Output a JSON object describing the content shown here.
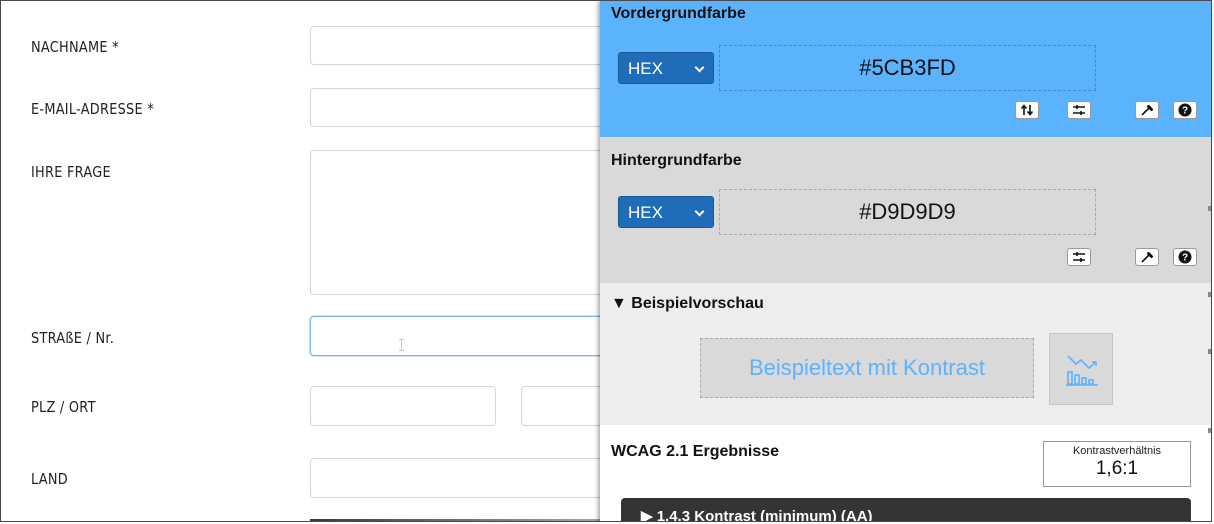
{
  "form": {
    "fields": [
      {
        "label": "NACHNAME *"
      },
      {
        "label": "E-MAIL-ADRESSE *"
      },
      {
        "label": "IHRE FRAGE"
      },
      {
        "label": "STRAßE / Nr."
      },
      {
        "label": "PLZ / ORT"
      },
      {
        "label": "LAND"
      }
    ]
  },
  "panel": {
    "foreground": {
      "title": "Vordergrundfarbe",
      "format": "HEX",
      "value": "#5CB3FD",
      "color": "#5cb3fd",
      "tools": [
        "swap-icon",
        "sliders-icon",
        "eyedropper-icon",
        "help-icon"
      ]
    },
    "background": {
      "title": "Hintergrundfarbe",
      "format": "HEX",
      "value": "#D9D9D9",
      "color": "#d9d9d9",
      "tools": [
        "sliders-icon",
        "eyedropper-icon",
        "help-icon"
      ]
    },
    "preview": {
      "title": "▼ Beispielvorschau",
      "sample_text": "Beispieltext mit Kontrast",
      "chart_button_icon": "contrast-chart-icon"
    },
    "wcag": {
      "title": "WCAG 2.1 Ergebnisse",
      "ratio_label": "Kontrastverhältnis",
      "ratio_value": "1,6:1",
      "criterion": "▶ 1.4.3 Kontrast (minimum) (AA)"
    }
  }
}
